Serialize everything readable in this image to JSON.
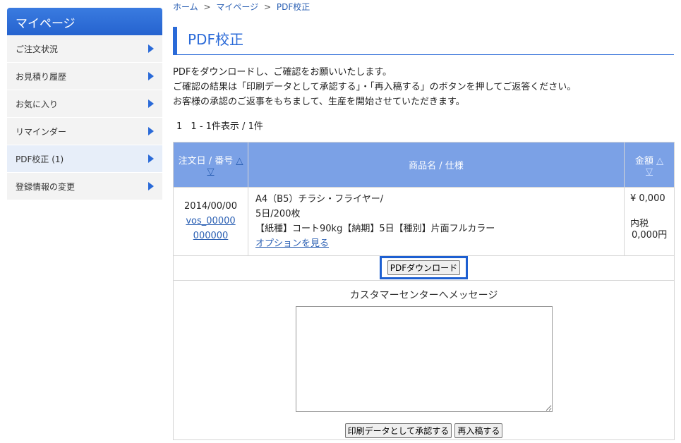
{
  "sidebar": {
    "title": "マイページ",
    "items": [
      {
        "label": "ご注文状況"
      },
      {
        "label": "お見積り履歴"
      },
      {
        "label": "お気に入り"
      },
      {
        "label": "リマインダー"
      },
      {
        "label": "PDF校正 (1)"
      },
      {
        "label": "登録情報の変更"
      }
    ]
  },
  "breadcrumb": {
    "home": "ホーム",
    "mypage": "マイページ",
    "current": "PDF校正",
    "sep": ">"
  },
  "page": {
    "title": "PDF校正",
    "intro": [
      "PDFをダウンロードし、ご確認をお願いいたします。",
      "ご確認の結果は「印刷データとして承認する」・「再入稿する」のボタンを押してご返答ください。",
      "お客様の承認のご返事をもちまして、生産を開始させていただきます。"
    ],
    "pager": {
      "page": "1",
      "summary": "1 - 1件表示 / 1件"
    }
  },
  "table": {
    "headers": {
      "date": "注文日 / 番号",
      "product": "商品名 / 仕様",
      "amount": "金額",
      "sort_up": "△",
      "sort_down": "▽"
    },
    "row": {
      "date": "2014/00/00",
      "order_no_1": "vos_00000",
      "order_no_2": "000000",
      "product_line1": "A4（B5）チラシ・フライヤー/",
      "product_line2": "5日/200枚",
      "product_line3": "【紙種】コート90kg【納期】5日【種別】片面フルカラー",
      "options_link": "オプションを見る",
      "price": "¥ 0,000",
      "tax_label": "内税",
      "tax_value": "0,000円"
    }
  },
  "download_button": "PDFダウンロード",
  "message": {
    "label": "カスタマーセンターへメッセージ",
    "text": ""
  },
  "actions": {
    "approve": "印刷データとして承認する",
    "resubmit": "再入稿する"
  }
}
